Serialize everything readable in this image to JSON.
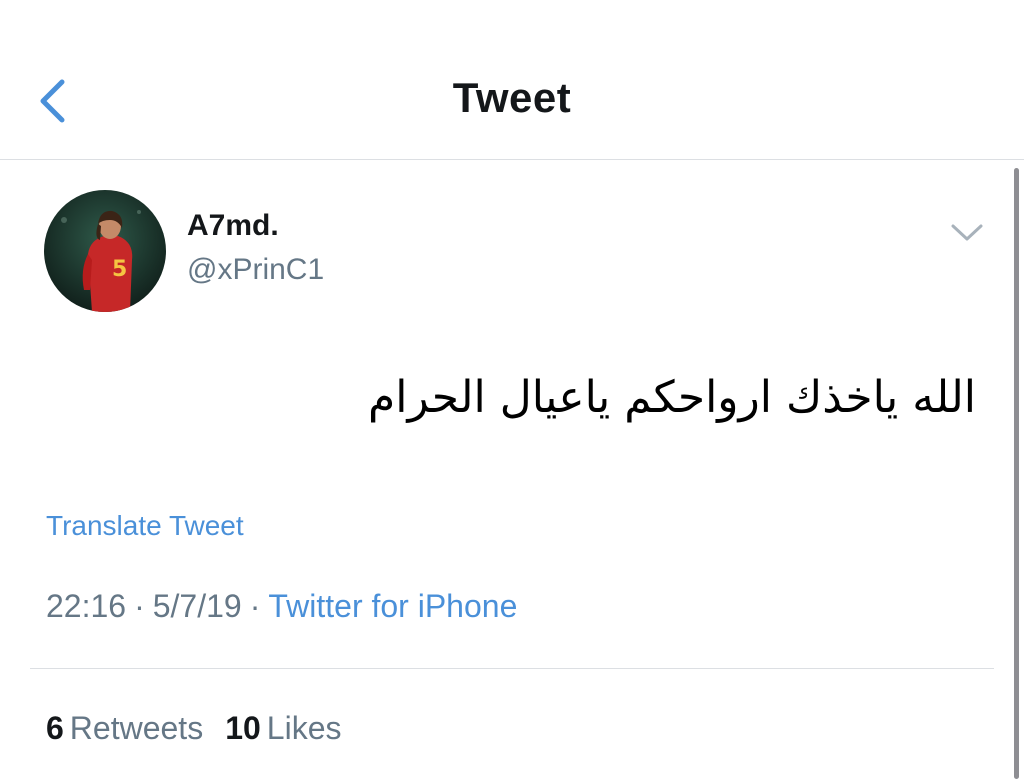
{
  "header": {
    "title": "Tweet",
    "back_icon": "chevron-left-icon"
  },
  "colors": {
    "link": "#4a90d9",
    "secondary_text": "#657786",
    "primary_text": "#14171a"
  },
  "tweet": {
    "author": {
      "name": "A7md.",
      "handle": "@xPrinC1"
    },
    "menu_icon": "chevron-down-icon",
    "text": "الله ياخذك ارواحكم ياعيال الحرام",
    "translate_label": "Translate Tweet",
    "time": "22:16",
    "date": "5/7/19",
    "separator": "·",
    "source": "Twitter for iPhone",
    "stats": {
      "retweets_count": "6",
      "retweets_label": "Retweets",
      "likes_count": "10",
      "likes_label": "Likes"
    }
  }
}
